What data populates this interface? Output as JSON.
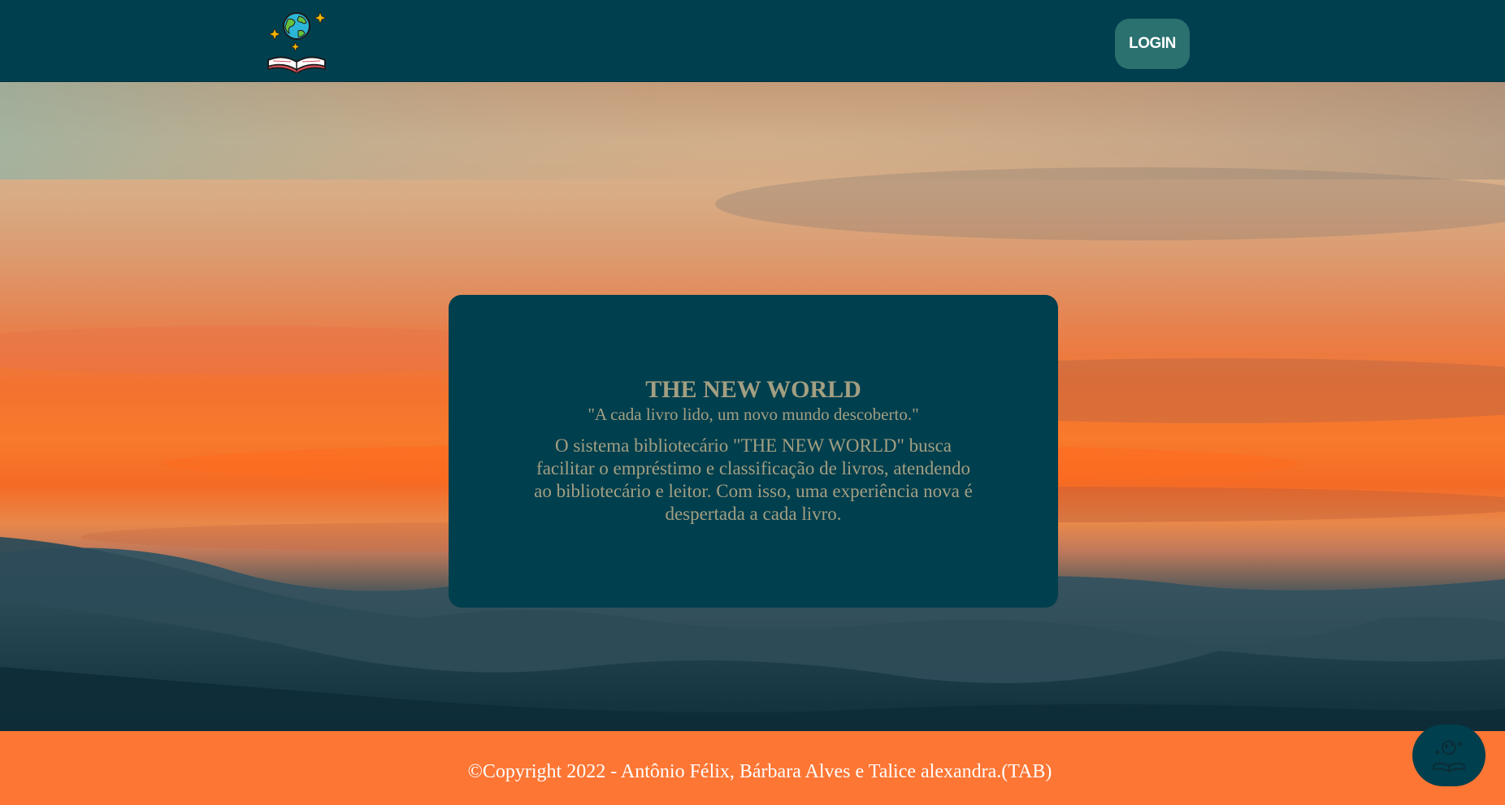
{
  "header": {
    "logo": "globe-book-logo",
    "login_label": "LOGIN"
  },
  "hero": {
    "background": "sunset-over-hills-photo"
  },
  "card": {
    "title": "THE NEW WORLD",
    "quote": "\"A cada livro lido, um novo mundo descoberto.\"",
    "description": "O sistema bibliotecário \"THE NEW WORLD\" busca facilitar o empréstimo e classificação de livros, atendendo ao bibliotecário e leitor. Com isso, uma experiência nova é despertada a cada livro."
  },
  "footer": {
    "copyright": "©Copyright 2022 - Antônio Félix, Bárbara Alves e Talice alexandra.(TAB)"
  },
  "floating_button": {
    "icon": "globe-book-icon"
  },
  "colors": {
    "primary": "#003f4e",
    "accent": "#fd7634",
    "login_button": "#2a7170",
    "card_text": "#a39f82"
  }
}
